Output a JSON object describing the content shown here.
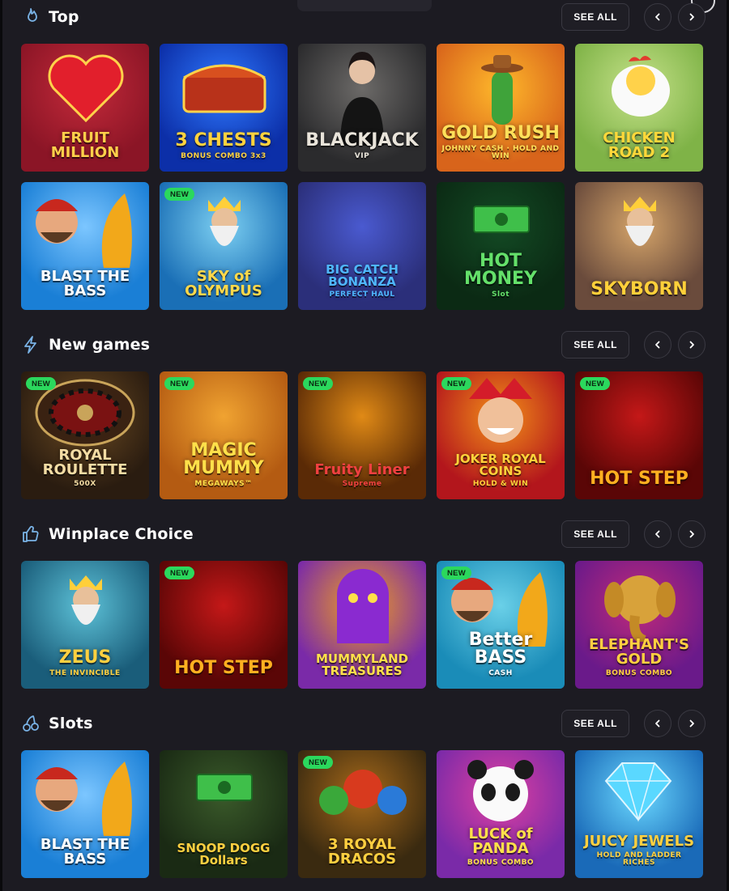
{
  "header": {
    "see_all": "SEE ALL"
  },
  "badge_label": "NEW",
  "sections": [
    {
      "title": "Top",
      "icon": "flame-icon",
      "rows": [
        [
          {
            "name": "FRUIT MILLION",
            "sub": "",
            "bg": "#8b1526",
            "bg2": "#c42a3a",
            "color": "#ffcf4a",
            "art": "heart"
          },
          {
            "name": "3 CHESTS",
            "sub": "BONUS COMBO 3x3",
            "bg": "#0c2fa8",
            "bg2": "#2f79ff",
            "color": "#ffd23e",
            "art": "chest"
          },
          {
            "name": "BLACKJACK",
            "sub": "VIP",
            "bg": "#2b2b2d",
            "bg2": "#6c6a68",
            "color": "#e9e4da",
            "art": "dealer"
          },
          {
            "name": "GOLD RUSH",
            "sub": "JOHNNY CASH · HOLD AND WIN",
            "bg": "#d8641b",
            "bg2": "#ffb92b",
            "color": "#ffe05a",
            "art": "cactus"
          },
          {
            "name": "CHICKEN ROAD 2",
            "sub": "",
            "bg": "#7fb347",
            "bg2": "#c6e28a",
            "color": "#ffd83a",
            "art": "chicken"
          }
        ],
        [
          {
            "name": "BLAST THE BASS",
            "sub": "",
            "bg": "#1a7fd6",
            "bg2": "#7cc6ff",
            "color": "#ffffff",
            "art": "fisher",
            "new": false
          },
          {
            "name": "SKY of OLYMPUS",
            "sub": "",
            "bg": "#1a6fb6",
            "bg2": "#7dd0f2",
            "color": "#ffd84a",
            "art": "god",
            "new": true
          },
          {
            "name": "BIG CATCH BONANZA",
            "sub": "PERFECT HAUL",
            "bg": "#2b2f7a",
            "bg2": "#4a5ad0",
            "color": "#4fb7ff",
            "art": "none",
            "new": false
          },
          {
            "name": "HOT MONEY",
            "sub": "Slot",
            "bg": "#0b2a14",
            "bg2": "#134a24",
            "color": "#64e06a",
            "art": "cash",
            "new": false
          },
          {
            "name": "SKYBORN",
            "sub": "",
            "bg": "#6a4b3c",
            "bg2": "#d6a56a",
            "color": "#ffd03a",
            "art": "god",
            "new": false
          }
        ]
      ]
    },
    {
      "title": "New games",
      "icon": "lightning-icon",
      "rows": [
        [
          {
            "name": "ROYAL ROULETTE",
            "sub": "500X",
            "bg": "#2a1c10",
            "bg2": "#6b4a22",
            "color": "#f3dca4",
            "art": "wheel",
            "new": true
          },
          {
            "name": "MAGIC MUMMY",
            "sub": "MEGAWAYS™",
            "bg": "#b45b12",
            "bg2": "#f0a331",
            "color": "#ffe04a",
            "art": "none",
            "new": true
          },
          {
            "name": "Fruity Liner",
            "sub": "Supreme",
            "bg": "#5a2a06",
            "bg2": "#e08a16",
            "color": "#f04040",
            "art": "none",
            "new": true
          },
          {
            "name": "JOKER ROYAL COINS",
            "sub": "HOLD & WIN",
            "bg": "#b3161c",
            "bg2": "#f39018",
            "color": "#ffd23a",
            "art": "joker",
            "new": true
          },
          {
            "name": "HOT STEP",
            "sub": "",
            "bg": "#5a0606",
            "bg2": "#c41818",
            "color": "#ffb020",
            "art": "none",
            "new": true
          }
        ]
      ]
    },
    {
      "title": "Winplace Choice",
      "icon": "thumbs-up-icon",
      "rows": [
        [
          {
            "name": "ZEUS",
            "sub": "THE INVINCIBLE",
            "bg": "#1a5d7a",
            "bg2": "#5dc2d8",
            "color": "#ffd040",
            "art": "god",
            "new": false
          },
          {
            "name": "HOT STEP",
            "sub": "",
            "bg": "#5a0606",
            "bg2": "#c41818",
            "color": "#ffb020",
            "art": "none",
            "new": true
          },
          {
            "name": "MUMMYLAND TREASURES",
            "sub": "",
            "bg": "#7a2aa8",
            "bg2": "#f0a020",
            "color": "#ffe04a",
            "art": "mummy",
            "new": false
          },
          {
            "name": "Better BASS",
            "sub": "CASH",
            "bg": "#1a8cb8",
            "bg2": "#6ad0e8",
            "color": "#ffffff",
            "art": "fisher",
            "new": true
          },
          {
            "name": "ELEPHANT'S GOLD",
            "sub": "BONUS COMBO",
            "bg": "#6a1a8a",
            "bg2": "#c02a7a",
            "color": "#ffd040",
            "art": "elephant",
            "new": false
          }
        ]
      ]
    },
    {
      "title": "Slots",
      "icon": "cherries-icon",
      "rows": [
        [
          {
            "name": "BLAST THE BASS",
            "sub": "",
            "bg": "#1a7fd6",
            "bg2": "#7cc6ff",
            "color": "#ffffff",
            "art": "fisher",
            "new": false
          },
          {
            "name": "SNOOP DOGG Dollars",
            "sub": "",
            "bg": "#1a2a14",
            "bg2": "#3a5a2a",
            "color": "#ffd040",
            "art": "cash",
            "new": false
          },
          {
            "name": "3 ROYAL DRACOS",
            "sub": "",
            "bg": "#3a2a10",
            "bg2": "#a86a1a",
            "color": "#ffcf40",
            "art": "dragon",
            "new": true
          },
          {
            "name": "LUCK of PANDA",
            "sub": "BONUS COMBO",
            "bg": "#7a2aa8",
            "bg2": "#e040a0",
            "color": "#ffe04a",
            "art": "panda",
            "new": false
          },
          {
            "name": "JUICY JEWELS",
            "sub": "HOLD AND LADDER RICHES",
            "bg": "#1a6ab8",
            "bg2": "#6ad8ff",
            "color": "#ffd040",
            "art": "jewel",
            "new": false
          }
        ]
      ]
    }
  ]
}
